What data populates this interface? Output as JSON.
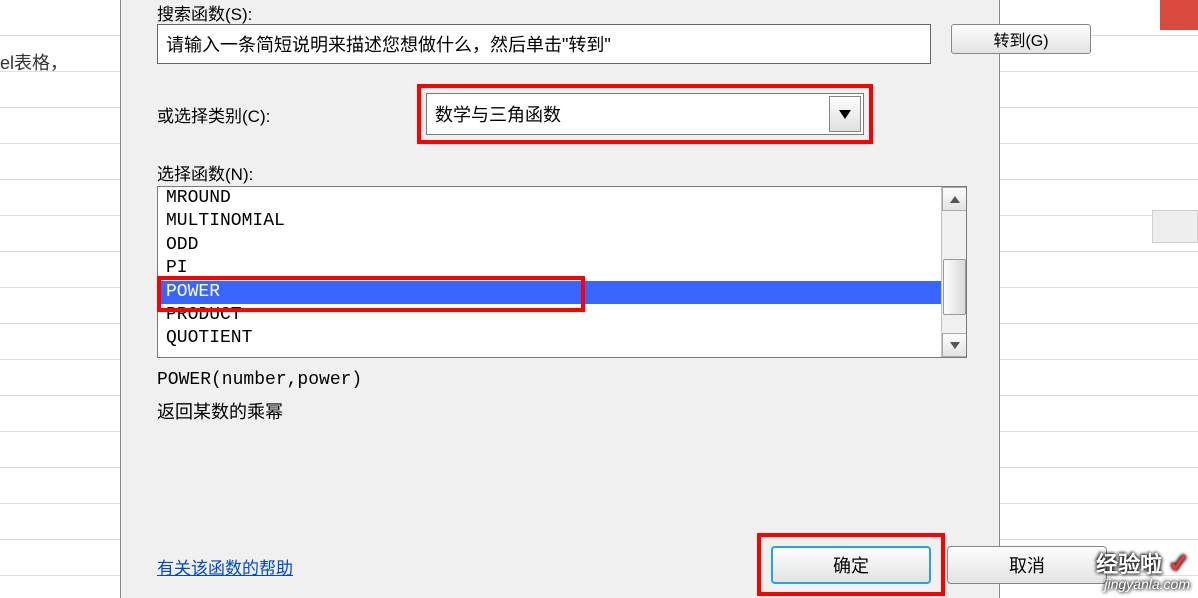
{
  "background": {
    "left_text": "el表格，"
  },
  "dialog": {
    "search_label": "搜索函数(S):",
    "search_input": "请输入一条简短说明来描述您想做什么，然后单击\"转到\"",
    "goto_button": "转到(G)",
    "category_label": "或选择类别(C):",
    "category_value": "数学与三角函数",
    "select_function_label": "选择函数(N):",
    "functions": [
      "MROUND",
      "MULTINOMIAL",
      "ODD",
      "PI",
      "POWER",
      "PRODUCT",
      "QUOTIENT"
    ],
    "selected_function_index": 4,
    "function_signature": "POWER(number,power)",
    "function_description": "返回某数的乘幂",
    "help_link": "有关该函数的帮助",
    "ok_button": "确定",
    "cancel_button": "取消"
  },
  "watermark": {
    "top": "经验啦",
    "bottom": "jingyanla.com"
  }
}
